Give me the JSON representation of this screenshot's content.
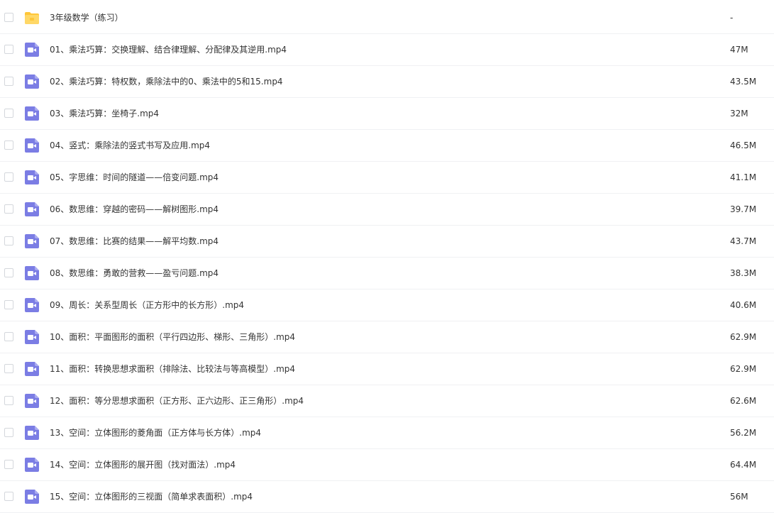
{
  "files": [
    {
      "name": "3年级数学（练习）",
      "size": "-",
      "icon": "folder-icon"
    },
    {
      "name": "01、乘法巧算：交换理解、结合律理解、分配律及其逆用.mp4",
      "size": "47M",
      "icon": "video-file-icon"
    },
    {
      "name": "02、乘法巧算：特权数，乘除法中的0、乘法中的5和15.mp4",
      "size": "43.5M",
      "icon": "video-file-icon"
    },
    {
      "name": "03、乘法巧算：坐椅子.mp4",
      "size": "32M",
      "icon": "video-file-icon"
    },
    {
      "name": "04、竖式：乘除法的竖式书写及应用.mp4",
      "size": "46.5M",
      "icon": "video-file-icon"
    },
    {
      "name": "05、字思维：时间的隧道——倍变问题.mp4",
      "size": "41.1M",
      "icon": "video-file-icon"
    },
    {
      "name": "06、数思维：穿越的密码——解树图形.mp4",
      "size": "39.7M",
      "icon": "video-file-icon"
    },
    {
      "name": "07、数思维：比赛的结果——解平均数.mp4",
      "size": "43.7M",
      "icon": "video-file-icon"
    },
    {
      "name": "08、数思维：勇敢的营救——盈亏问题.mp4",
      "size": "38.3M",
      "icon": "video-file-icon"
    },
    {
      "name": "09、周长：关系型周长（正方形中的长方形）.mp4",
      "size": "40.6M",
      "icon": "video-file-icon"
    },
    {
      "name": "10、面积：平面图形的面积（平行四边形、梯形、三角形）.mp4",
      "size": "62.9M",
      "icon": "video-file-icon"
    },
    {
      "name": "11、面积：转换思想求面积（排除法、比较法与等高模型）.mp4",
      "size": "62.9M",
      "icon": "video-file-icon"
    },
    {
      "name": "12、面积：等分思想求面积（正方形、正六边形、正三角形）.mp4",
      "size": "62.6M",
      "icon": "video-file-icon"
    },
    {
      "name": "13、空间：立体图形的菱角面（正方体与长方体）.mp4",
      "size": "56.2M",
      "icon": "video-file-icon"
    },
    {
      "name": "14、空间：立体图形的展开图（找对面法）.mp4",
      "size": "64.4M",
      "icon": "video-file-icon"
    },
    {
      "name": "15、空间：立体图形的三视面（简单求表面积）.mp4",
      "size": "56M",
      "icon": "video-file-icon"
    }
  ],
  "colors": {
    "folder": "#ffc638",
    "folder_tab": "#ffd867",
    "video": "#7b7de4"
  }
}
